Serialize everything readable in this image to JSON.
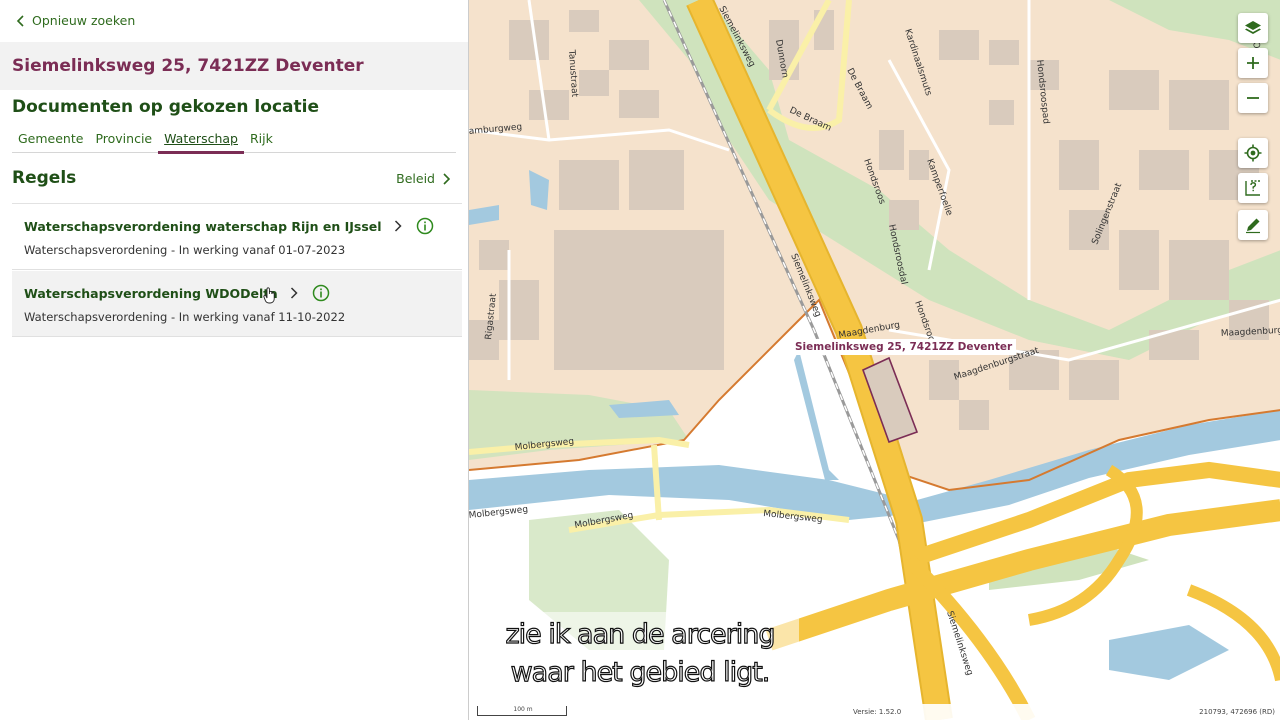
{
  "panel": {
    "back_label": "Opnieuw zoeken",
    "address": "Siemelinksweg 25, 7421ZZ Deventer",
    "documents_title": "Documenten op gekozen locatie",
    "tabs": [
      {
        "label": "Gemeente"
      },
      {
        "label": "Provincie"
      },
      {
        "label": "Waterschap",
        "active": true
      },
      {
        "label": "Rijk"
      }
    ],
    "section_title": "Regels",
    "beleid_label": "Beleid",
    "rules": [
      {
        "name": "Waterschapsverordening waterschap Rijn en IJssel",
        "subtitle": "Waterschapsverordening - In werking vanaf 01-07-2023"
      },
      {
        "name": "Waterschapsverordening WDODelta",
        "subtitle": "Waterschapsverordening - In werking vanaf 11-10-2022"
      }
    ]
  },
  "map": {
    "pin_label": "Siemelinksweg 25, 7421ZZ Deventer",
    "streets": {
      "s1": "Siemelinksweg",
      "s2": "Siemelinksweg",
      "s3": "Siemelinksweg",
      "dunnorn": "Dunnorn",
      "braam": "De Braam",
      "braam2": "De Braam",
      "kardinaalsmuts": "Kardinaalsmuts",
      "hondsroospad": "Hondsroospad",
      "hondsroos": "Hondsroos",
      "hondsroosdal": "Hondsroosdal",
      "kamperfoelie": "Kamperfoelie",
      "solingen": "Solingenstraat",
      "maagdenburgstraat": "Maagdenburgstraat",
      "maagdenburgstraat2": "Maagdenburgstraat",
      "maagdenburg": "Maagdenburg",
      "hondsroo2": "Hondsroo",
      "tanustraat": "Tanustraat",
      "hamburgweg": "amburgweg",
      "rigastraat": "Rigastraat",
      "molbergsweg1": "Molbergsweg",
      "molbergsweg2": "Molbergsweg",
      "molbergsweg3": "Molbergsweg",
      "molbergsweg4": "Molbergsweg",
      "overijssel": "Overijs"
    },
    "scale_label": "100 m",
    "version": "Versie: 1.52.0",
    "coords": "210793, 472696 (RD)",
    "colors": {
      "land": "#f5e2cc",
      "building": "#d9cbbd",
      "water": "#a3c9df",
      "green": "#cfe3bd",
      "highway": "#f5c542",
      "road": "#faf0a8",
      "boundary": "#d57a30",
      "plot": "#7b2d55"
    }
  },
  "tools": [
    {
      "name": "layers-icon"
    },
    {
      "name": "zoom-in-icon"
    },
    {
      "name": "zoom-out-icon"
    },
    {
      "name": "locate-icon"
    },
    {
      "name": "query-icon"
    },
    {
      "name": "draw-icon"
    }
  ],
  "subtitle": {
    "line1": "zie ik aan de arcering",
    "line2": "waar het gebied ligt."
  }
}
